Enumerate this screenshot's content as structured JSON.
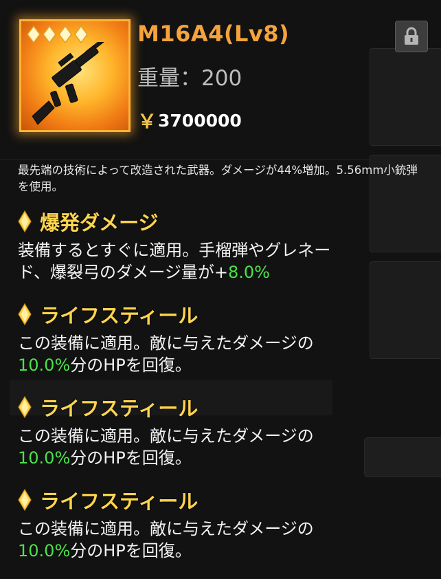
{
  "item": {
    "name": "M16A4(Lv8)",
    "weight_text": "重量：200",
    "currency_symbol": "￥",
    "price": "3700000",
    "star_count": 4,
    "rarity_color": "#ffb338",
    "icons": {
      "rarity": "diamond-star-icon",
      "image": "rifle-icon",
      "lock": "lock-icon"
    }
  },
  "description": "最先端の技術によって改造された武器。ダメージが44%増加。5.56mm小銃弾を使用。",
  "skills": [
    {
      "title": "爆発ダメージ",
      "line1": "装備するとすぐに適用。手榴弾やグレネー",
      "line2_prefix": "ド、爆裂弓のダメージ量が+",
      "value": "8.0%",
      "line2_suffix": ""
    },
    {
      "title": "ライフスティール",
      "line1": "この装備に適用。敵に与えたダメージの",
      "line2_prefix": "",
      "value": "10.0%",
      "line2_suffix": "分のHPを回復。"
    },
    {
      "title": "ライフスティール",
      "line1": "この装備に適用。敵に与えたダメージの",
      "line2_prefix": "",
      "value": "10.0%",
      "line2_suffix": "分のHPを回復。"
    },
    {
      "title": "ライフスティール",
      "line1": "この装備に適用。敵に与えたダメージの",
      "line2_prefix": "",
      "value": "10.0%",
      "line2_suffix": "分のHPを回復。"
    }
  ],
  "colors": {
    "name": "#f6a33c",
    "skill_title": "#ffd54d",
    "highlight": "#4be34b",
    "background": "#121212"
  }
}
